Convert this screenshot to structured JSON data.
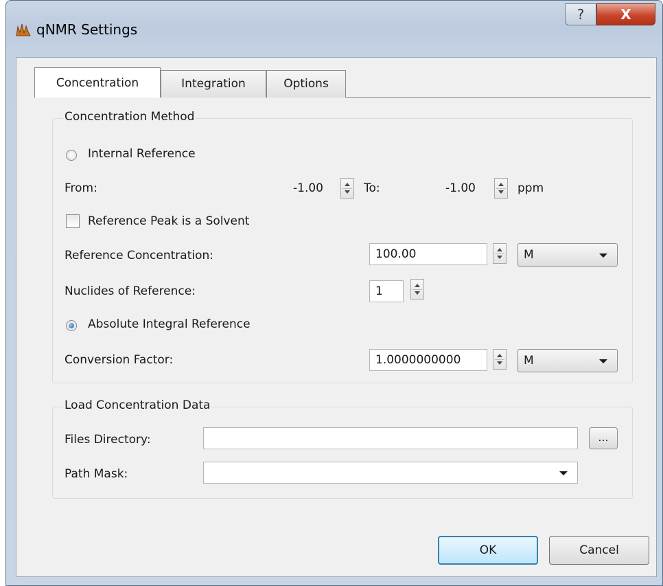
{
  "window": {
    "title": "qNMR Settings",
    "help_label": "?",
    "close_label": "X"
  },
  "tabs": [
    {
      "label": "Concentration",
      "active": true
    },
    {
      "label": "Integration",
      "active": false
    },
    {
      "label": "Options",
      "active": false
    }
  ],
  "concentration_method": {
    "group_title": "Concentration Method",
    "internal_reference_label": "Internal Reference",
    "internal_reference_selected": false,
    "from_label": "From:",
    "from_value": "-1.00",
    "to_label": "To:",
    "to_value": "-1.00",
    "ppm_unit": "ppm",
    "solvent_checkbox_label": "Reference Peak is a Solvent",
    "solvent_checked": false,
    "ref_conc_label": "Reference Concentration:",
    "ref_conc_value": "100.00",
    "ref_conc_unit": "M",
    "nuclides_label": "Nuclides of Reference:",
    "nuclides_value": "1",
    "absolute_integral_label": "Absolute Integral Reference",
    "absolute_integral_selected": true,
    "conversion_label": "Conversion Factor:",
    "conversion_value": "1.0000000000",
    "conversion_unit": "M"
  },
  "load_data": {
    "group_title": "Load Concentration Data",
    "files_dir_label": "Files Directory:",
    "files_dir_value": "",
    "browse_label": "...",
    "path_mask_label": "Path Mask:",
    "path_mask_value": ""
  },
  "buttons": {
    "ok_label": "OK",
    "cancel_label": "Cancel"
  }
}
